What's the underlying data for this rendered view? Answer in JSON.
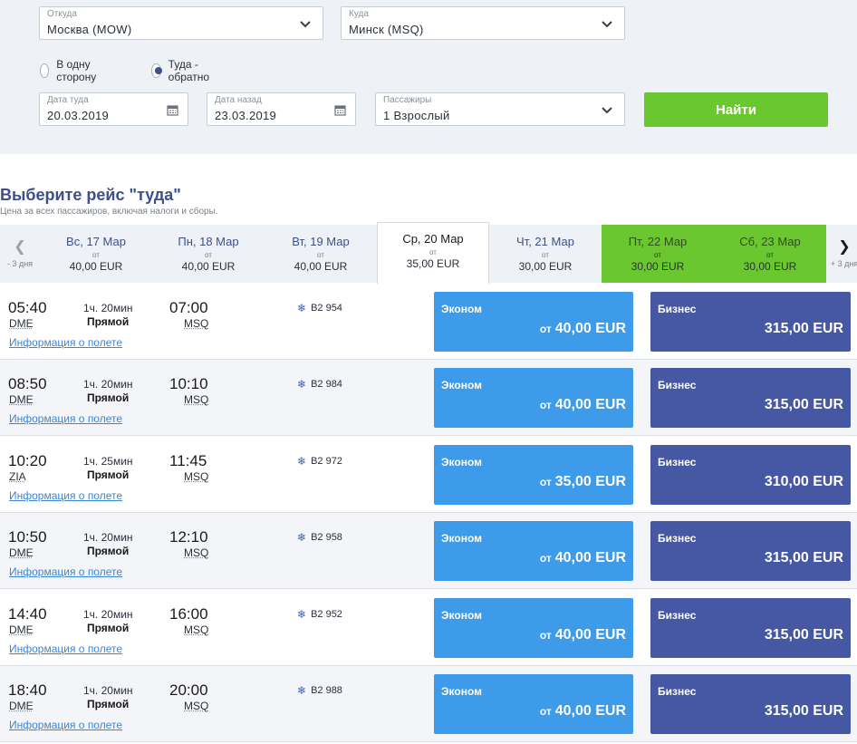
{
  "search": {
    "from_label": "Откуда",
    "from_value": "Москва (MOW)",
    "to_label": "Куда",
    "to_value": "Минск (MSQ)",
    "trip_one_way": "В одну сторону",
    "trip_round": "Туда - обратно",
    "depart_label": "Дата туда",
    "depart_value": "20.03.2019",
    "return_label": "Дата назад",
    "return_value": "23.03.2019",
    "pax_label": "Пассажиры",
    "pax_value": "1 Взрослый",
    "find_label": "Найти"
  },
  "results": {
    "title": "Выберите рейс \"туда\"",
    "subtitle": "Цена за всех пассажиров, включая налоги и сборы.",
    "prev_label": "- 3 дня",
    "next_label": "+ 3 дня",
    "from_word": "от",
    "days": [
      {
        "name": "Вс, 17 Мар",
        "price": "40,00 EUR"
      },
      {
        "name": "Пн, 18 Мар",
        "price": "40,00 EUR"
      },
      {
        "name": "Вт, 19 Мар",
        "price": "40,00 EUR"
      },
      {
        "name": "Ср, 20 Мар",
        "price": "35,00 EUR"
      },
      {
        "name": "Чт, 21 Мар",
        "price": "30,00 EUR"
      },
      {
        "name": "Пт, 22 Мар",
        "price": "30,00 EUR"
      },
      {
        "name": "Сб, 23 Мар",
        "price": "30,00 EUR"
      }
    ],
    "economy_label": "Эконом",
    "business_label": "Бизнес",
    "info_link": "Информация о полете",
    "direct_label": "Прямой",
    "flights": [
      {
        "dep": "05:40",
        "dep_ap": "DME",
        "dur": "1ч. 20мин",
        "arr": "07:00",
        "arr_ap": "MSQ",
        "no": "B2 954",
        "eco": "40,00 EUR",
        "biz": "315,00 EUR"
      },
      {
        "dep": "08:50",
        "dep_ap": "DME",
        "dur": "1ч. 20мин",
        "arr": "10:10",
        "arr_ap": "MSQ",
        "no": "B2 984",
        "eco": "40,00 EUR",
        "biz": "315,00 EUR"
      },
      {
        "dep": "10:20",
        "dep_ap": "ZIA",
        "dur": "1ч. 25мин",
        "arr": "11:45",
        "arr_ap": "MSQ",
        "no": "B2 972",
        "eco": "35,00 EUR",
        "biz": "310,00 EUR"
      },
      {
        "dep": "10:50",
        "dep_ap": "DME",
        "dur": "1ч. 20мин",
        "arr": "12:10",
        "arr_ap": "MSQ",
        "no": "B2 958",
        "eco": "40,00 EUR",
        "biz": "315,00 EUR"
      },
      {
        "dep": "14:40",
        "dep_ap": "DME",
        "dur": "1ч. 20мин",
        "arr": "16:00",
        "arr_ap": "MSQ",
        "no": "B2 952",
        "eco": "40,00 EUR",
        "biz": "315,00 EUR"
      },
      {
        "dep": "18:40",
        "dep_ap": "DME",
        "dur": "1ч. 20мин",
        "arr": "20:00",
        "arr_ap": "MSQ",
        "no": "B2 988",
        "eco": "40,00 EUR",
        "biz": "315,00 EUR"
      }
    ]
  },
  "colors": {
    "economy": "#3d9be9",
    "business": "#4658a3",
    "accent_green": "#6bc72f",
    "title_blue": "#3f4f8c"
  },
  "icons": {
    "dropdown": "chevron-down-icon",
    "calendar": "calendar-icon",
    "airline": "snowflake-icon",
    "prev": "chevron-left-icon",
    "next": "chevron-right-icon"
  }
}
